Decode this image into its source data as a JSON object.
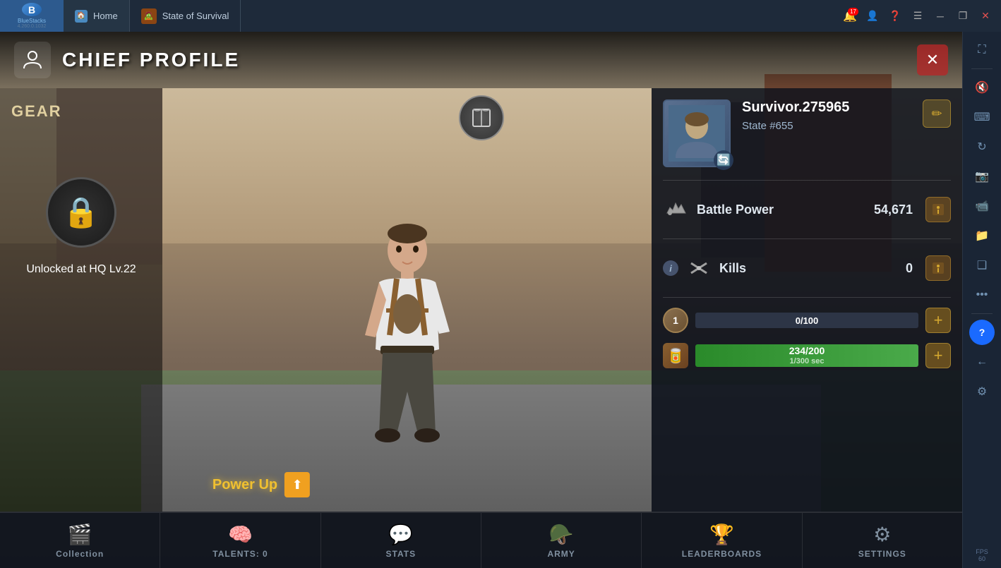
{
  "titlebar": {
    "app_name": "BlueStacks",
    "app_version": "4.260.0.1032",
    "tab_home": "Home",
    "tab_game": "State of Survival",
    "notification_count": "17",
    "window_controls": [
      "minimize",
      "restore",
      "close"
    ]
  },
  "header": {
    "title": "CHIEF PROFILE",
    "icon": "👤",
    "close_btn": "✕"
  },
  "gear_panel": {
    "title": "GEAR",
    "lock_icon": "🔒",
    "unlock_text": "Unlocked at HQ\nLv.22"
  },
  "center": {
    "book_icon": "📖",
    "power_up_label": "Power Up",
    "power_up_icon": "⬆"
  },
  "profile": {
    "username": "Survivor.275965",
    "state": "State #655",
    "edit_icon": "✏",
    "refresh_icon": "🔄",
    "battle_power": {
      "label": "Battle Power",
      "value": "54,671",
      "icon": "🔫"
    },
    "kills": {
      "label": "Kills",
      "value": "0",
      "icon": "⚔"
    },
    "level": {
      "badge": "1",
      "current": "0",
      "max": "100"
    },
    "food": {
      "current": "234",
      "max": "200",
      "rate": "1/300 sec",
      "fill_percent": 100
    }
  },
  "bottom_nav": [
    {
      "icon": "🎬",
      "label": "Collection"
    },
    {
      "icon": "🧠",
      "label": "TALENTS: 0"
    },
    {
      "icon": "💬",
      "label": "STATS"
    },
    {
      "icon": "🪖",
      "label": "ARMY"
    },
    {
      "icon": "🏆",
      "label": "LEADERBOARDS"
    },
    {
      "icon": "⚙",
      "label": "SETTINGS"
    }
  ],
  "right_sidebar": {
    "tools": [
      {
        "name": "fullscreen-icon",
        "symbol": "⛶"
      },
      {
        "name": "sound-icon",
        "symbol": "🔇"
      },
      {
        "name": "keyboard-icon",
        "symbol": "⌨"
      },
      {
        "name": "rotate-icon",
        "symbol": "🔄"
      },
      {
        "name": "screenshot-icon",
        "symbol": "📷"
      },
      {
        "name": "video-icon",
        "symbol": "📹"
      },
      {
        "name": "folder-icon",
        "symbol": "📁"
      },
      {
        "name": "layers-icon",
        "symbol": "❑"
      },
      {
        "name": "more-icon",
        "symbol": "…"
      },
      {
        "name": "back-icon",
        "symbol": "←"
      },
      {
        "name": "help-icon",
        "symbol": "?"
      },
      {
        "name": "settings-icon",
        "symbol": "⚙"
      }
    ]
  },
  "fps": "FPS\n60"
}
